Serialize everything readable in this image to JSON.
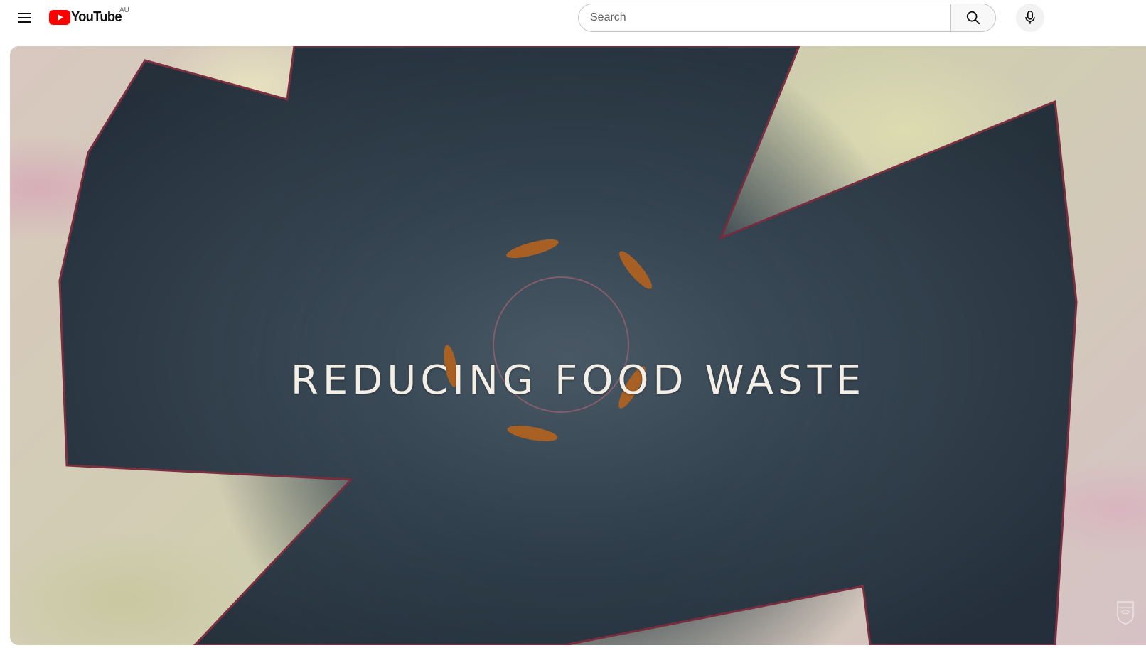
{
  "header": {
    "menu_icon": "hamburger-menu-icon",
    "logo_text": "YouTube",
    "region_code": "AU",
    "search": {
      "placeholder": "Search",
      "value": ""
    },
    "search_icon": "search-icon",
    "mic_icon": "microphone-icon"
  },
  "player": {
    "overlay_title": "REDUCING FOOD WASTE",
    "watermark_icon": "channel-crest-watermark-icon"
  },
  "colors": {
    "brand_red": "#ff0000",
    "text_primary": "#0f0f0f",
    "text_secondary": "#606060",
    "border": "#c6c6c6"
  }
}
